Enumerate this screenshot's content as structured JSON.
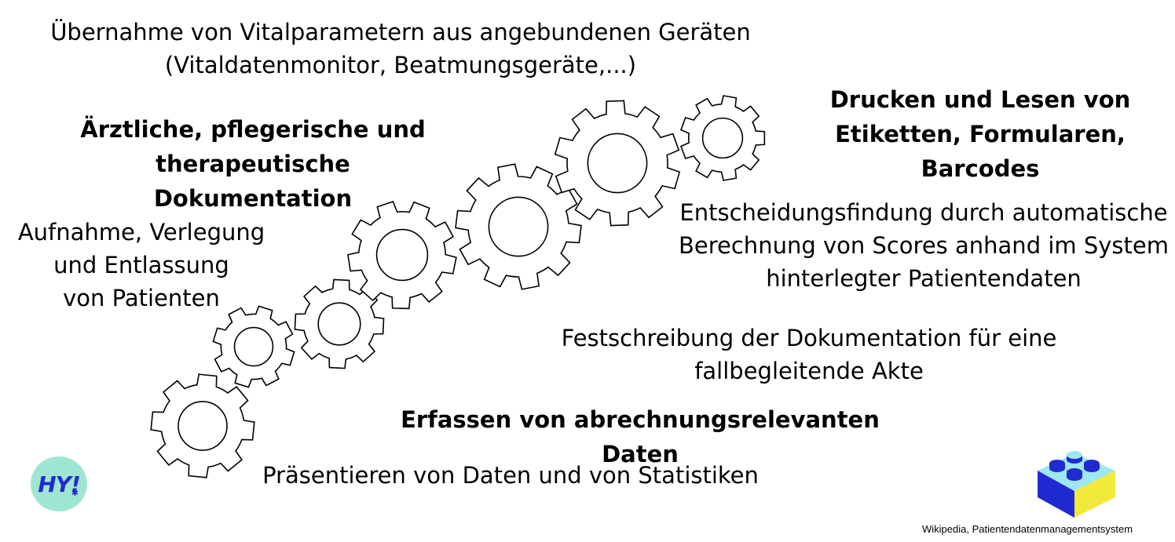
{
  "texts": {
    "vital": "Übernahme von Vitalparametern aus angebundenen Geräten\n(Vitaldatenmonitor, Beatmungsgeräte,...)",
    "doku": "Ärztliche, pflegerische und therapeutische\nDokumentation",
    "aufnahme": "Aufnahme, Verlegung\nund Entlassung\nvon Patienten",
    "drucken": "Drucken und Lesen von\nEtiketten, Formularen, Barcodes",
    "entscheidung": "Entscheidungsfindung durch automatische\nBerechnung von Scores anhand im System\nhinterlegter Patientendaten",
    "festschreibung": "Festschreibung der Dokumentation für eine\nfallbegleitende Akte",
    "erfassen": "Erfassen von abrechnungsrelevanten Daten",
    "praesentieren": "Präsentieren von Daten und von Statistiken"
  },
  "logo": {
    "text": "HY!"
  },
  "credit": "Wikipedia, Patientendatenmanagementsystem",
  "colors": {
    "logo_bg": "#9ee6d2",
    "logo_text": "#1f2bd0",
    "brick_top": "#9ee6f0",
    "brick_left": "#1f2bd0",
    "brick_right": "#f2ea3a"
  }
}
